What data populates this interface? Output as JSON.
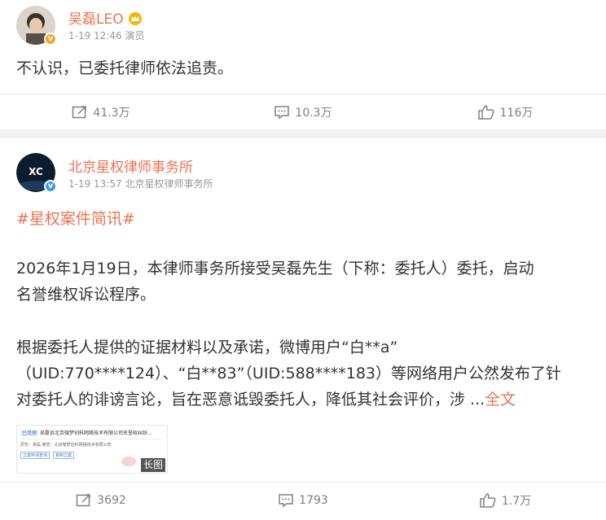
{
  "post1": {
    "author": "吴磊LEO",
    "meta": "1-19 12:46 演员",
    "text": "不认识，已委托律师依法追责。",
    "actions": {
      "repost": "41.3万",
      "comment": "10.3万",
      "like": "116万"
    }
  },
  "post2": {
    "author": "北京星权律师事务所",
    "meta": "1-19 13:57 北京星权律师事务所",
    "avatar_text": "XC",
    "hashtag": "#星权案件简讯#",
    "para1_line1": "2026年1月19日，本律师事务所接受吴磊先生（下称：委托人）委托，启动",
    "para1_line2": "名誉维权诉讼程序。",
    "para2_line1": "根据委托人提供的证据材料以及承诺，微博用户“白**a”",
    "para2_line2": "（UID:770****124）、“白**83”（UID:588****183）等网络用户公然发布了针",
    "para2_line3": "对委托人的诽谤言论，旨在恶意诋毁委托人，降低其社会评价，涉 ...",
    "more_link": "全文",
    "thumb": {
      "title": "吴磊诉北京微梦创科网络技术有限公司名誉权纠纷…",
      "tag": "已受理",
      "row": "原告：吴磊  被告：北京微梦创科网络技术有限公司",
      "btn1": "立案申请查询",
      "btn2": "复制立案",
      "long_label": "长图"
    },
    "actions": {
      "repost": "3692",
      "comment": "1793",
      "like": "1.7万"
    }
  }
}
